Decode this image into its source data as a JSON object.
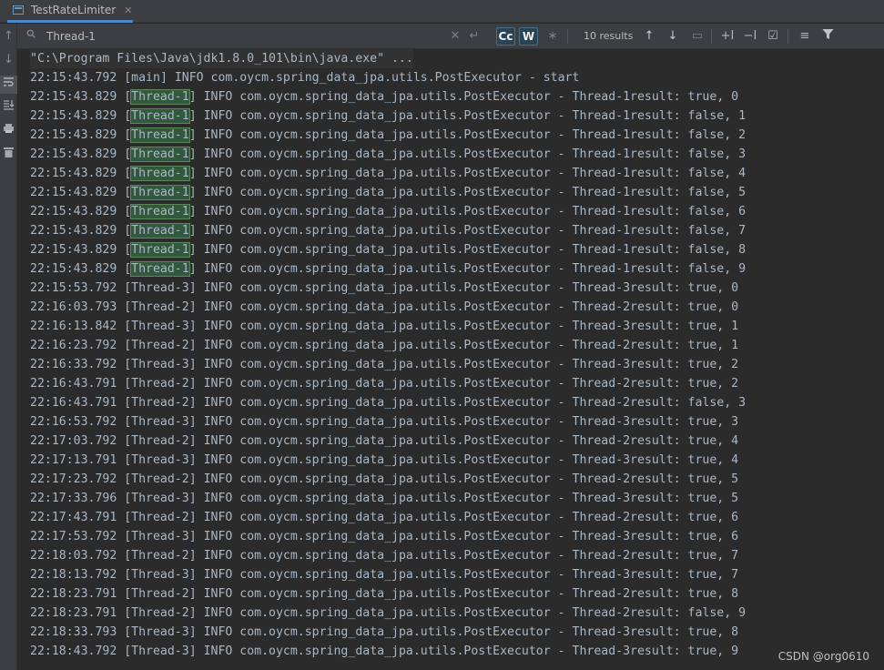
{
  "tab": {
    "title": "TestRateLimiter",
    "close": "✕"
  },
  "find": {
    "query": "Thread-1",
    "match_case": "Cc",
    "whole_words": "W",
    "results": "10 results"
  },
  "console": {
    "command": "\"C:\\Program Files\\Java\\jdk1.8.0_101\\bin\\java.exe\" ...",
    "lines": [
      {
        "time": "22:15:43.792",
        "thread": "main",
        "msg": "] INFO com.oycm.spring_data_jpa.utils.PostExecutor - start"
      },
      {
        "time": "22:15:43.829",
        "thread": "Thread-1",
        "msg": "] INFO com.oycm.spring_data_jpa.utils.PostExecutor - Thread-1result: true, 0"
      },
      {
        "time": "22:15:43.829",
        "thread": "Thread-1",
        "msg": "] INFO com.oycm.spring_data_jpa.utils.PostExecutor - Thread-1result: false, 1"
      },
      {
        "time": "22:15:43.829",
        "thread": "Thread-1",
        "msg": "] INFO com.oycm.spring_data_jpa.utils.PostExecutor - Thread-1result: false, 2"
      },
      {
        "time": "22:15:43.829",
        "thread": "Thread-1",
        "msg": "] INFO com.oycm.spring_data_jpa.utils.PostExecutor - Thread-1result: false, 3"
      },
      {
        "time": "22:15:43.829",
        "thread": "Thread-1",
        "msg": "] INFO com.oycm.spring_data_jpa.utils.PostExecutor - Thread-1result: false, 4"
      },
      {
        "time": "22:15:43.829",
        "thread": "Thread-1",
        "msg": "] INFO com.oycm.spring_data_jpa.utils.PostExecutor - Thread-1result: false, 5"
      },
      {
        "time": "22:15:43.829",
        "thread": "Thread-1",
        "msg": "] INFO com.oycm.spring_data_jpa.utils.PostExecutor - Thread-1result: false, 6"
      },
      {
        "time": "22:15:43.829",
        "thread": "Thread-1",
        "msg": "] INFO com.oycm.spring_data_jpa.utils.PostExecutor - Thread-1result: false, 7"
      },
      {
        "time": "22:15:43.829",
        "thread": "Thread-1",
        "msg": "] INFO com.oycm.spring_data_jpa.utils.PostExecutor - Thread-1result: false, 8"
      },
      {
        "time": "22:15:43.829",
        "thread": "Thread-1",
        "msg": "] INFO com.oycm.spring_data_jpa.utils.PostExecutor - Thread-1result: false, 9"
      },
      {
        "time": "22:15:53.792",
        "thread": "Thread-3",
        "msg": "] INFO com.oycm.spring_data_jpa.utils.PostExecutor - Thread-3result: true, 0"
      },
      {
        "time": "22:16:03.793",
        "thread": "Thread-2",
        "msg": "] INFO com.oycm.spring_data_jpa.utils.PostExecutor - Thread-2result: true, 0"
      },
      {
        "time": "22:16:13.842",
        "thread": "Thread-3",
        "msg": "] INFO com.oycm.spring_data_jpa.utils.PostExecutor - Thread-3result: true, 1"
      },
      {
        "time": "22:16:23.792",
        "thread": "Thread-2",
        "msg": "] INFO com.oycm.spring_data_jpa.utils.PostExecutor - Thread-2result: true, 1"
      },
      {
        "time": "22:16:33.792",
        "thread": "Thread-3",
        "msg": "] INFO com.oycm.spring_data_jpa.utils.PostExecutor - Thread-3result: true, 2"
      },
      {
        "time": "22:16:43.791",
        "thread": "Thread-2",
        "msg": "] INFO com.oycm.spring_data_jpa.utils.PostExecutor - Thread-2result: true, 2"
      },
      {
        "time": "22:16:43.791",
        "thread": "Thread-2",
        "msg": "] INFO com.oycm.spring_data_jpa.utils.PostExecutor - Thread-2result: false, 3"
      },
      {
        "time": "22:16:53.792",
        "thread": "Thread-3",
        "msg": "] INFO com.oycm.spring_data_jpa.utils.PostExecutor - Thread-3result: true, 3"
      },
      {
        "time": "22:17:03.792",
        "thread": "Thread-2",
        "msg": "] INFO com.oycm.spring_data_jpa.utils.PostExecutor - Thread-2result: true, 4"
      },
      {
        "time": "22:17:13.791",
        "thread": "Thread-3",
        "msg": "] INFO com.oycm.spring_data_jpa.utils.PostExecutor - Thread-3result: true, 4"
      },
      {
        "time": "22:17:23.792",
        "thread": "Thread-2",
        "msg": "] INFO com.oycm.spring_data_jpa.utils.PostExecutor - Thread-2result: true, 5"
      },
      {
        "time": "22:17:33.796",
        "thread": "Thread-3",
        "msg": "] INFO com.oycm.spring_data_jpa.utils.PostExecutor - Thread-3result: true, 5"
      },
      {
        "time": "22:17:43.791",
        "thread": "Thread-2",
        "msg": "] INFO com.oycm.spring_data_jpa.utils.PostExecutor - Thread-2result: true, 6"
      },
      {
        "time": "22:17:53.792",
        "thread": "Thread-3",
        "msg": "] INFO com.oycm.spring_data_jpa.utils.PostExecutor - Thread-3result: true, 6"
      },
      {
        "time": "22:18:03.792",
        "thread": "Thread-2",
        "msg": "] INFO com.oycm.spring_data_jpa.utils.PostExecutor - Thread-2result: true, 7"
      },
      {
        "time": "22:18:13.792",
        "thread": "Thread-3",
        "msg": "] INFO com.oycm.spring_data_jpa.utils.PostExecutor - Thread-3result: true, 7"
      },
      {
        "time": "22:18:23.791",
        "thread": "Thread-2",
        "msg": "] INFO com.oycm.spring_data_jpa.utils.PostExecutor - Thread-2result: true, 8"
      },
      {
        "time": "22:18:23.791",
        "thread": "Thread-2",
        "msg": "] INFO com.oycm.spring_data_jpa.utils.PostExecutor - Thread-2result: false, 9"
      },
      {
        "time": "22:18:33.793",
        "thread": "Thread-3",
        "msg": "] INFO com.oycm.spring_data_jpa.utils.PostExecutor - Thread-3result: true, 8"
      },
      {
        "time": "22:18:43.792",
        "thread": "Thread-3",
        "msg": "] INFO com.oycm.spring_data_jpa.utils.PostExecutor - Thread-3result: true, 9"
      }
    ]
  },
  "watermark": "CSDN @org0610",
  "icons": {
    "tab": "console-tab-icon",
    "search": "search-icon",
    "clear": "clear-icon",
    "newline": "newline-icon",
    "regex": "regex-icon",
    "up": "arrow-up-icon",
    "down": "arrow-down-icon",
    "select_all": "select-all-icon",
    "add_occ": "add-occurrence-icon",
    "remove_occ": "remove-occurrence-icon",
    "select_all_occ": "select-all-occurrences-icon",
    "filter_lines": "filter-lines-icon",
    "filter": "filter-icon",
    "soft_wrap": "soft-wrap-icon",
    "scroll_end": "scroll-to-end-icon",
    "print": "print-icon",
    "trash": "trash-icon"
  },
  "colors": {
    "background": "#2b2b2b",
    "text": "#a9b7c6",
    "highlight": "#32593d",
    "accent": "#4a88c7"
  },
  "highlight_term": "Thread-1"
}
